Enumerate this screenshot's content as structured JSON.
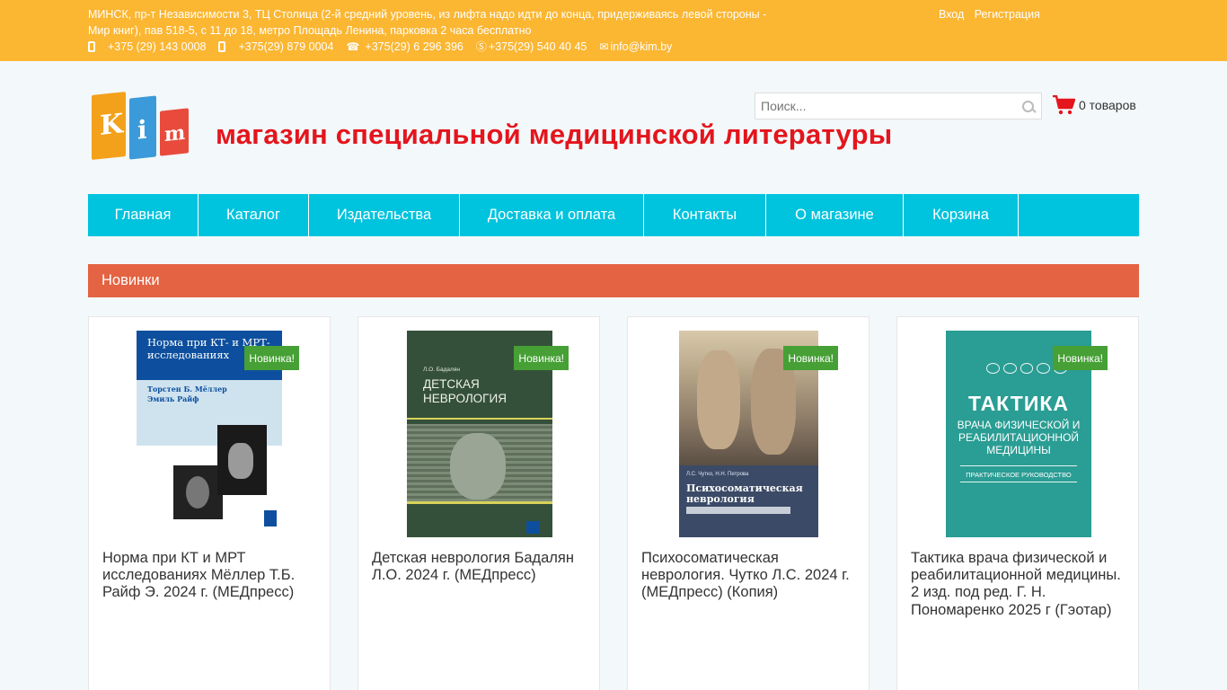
{
  "topbar": {
    "address": "МИНСК, пр-т Независимости 3, ТЦ Столица (2-й средний уровень, из лифта надо идти до конца, придерживаясь левой стороны - Мир книг), пав 518-5, с 11 до 18, метро Площадь Ленина, парковка 2 часа бесплатно",
    "phone1": "+375 (29) 143 0008",
    "phone2": "+375(29) 879 0004",
    "phone3": "+375(29) 6 296 396",
    "skype": "+375(29) 540 40 45",
    "email": "info@kim.by",
    "login": "Вход",
    "register": "Регистрация"
  },
  "header": {
    "logo_letters": [
      "K",
      "i",
      "m"
    ],
    "tagline": "магазин специальной медицинской литературы",
    "search_placeholder": "Поиск...",
    "cart_text": "0 товаров"
  },
  "nav": {
    "items": [
      "Главная",
      "Каталог",
      "Издательства",
      "Доставка и оплата",
      "Контакты",
      "О магазине",
      "Корзина"
    ]
  },
  "section_title": "Новинки",
  "products": [
    {
      "badge": "Новинка!",
      "title": "Норма при КТ и МРТ исследованиях Мёллер Т.Б. Райф Э. 2024 г. (МЕДпресс)",
      "cover_title": "Норма при КТ- и МРТ-исследованиях",
      "cover_authors": "Торстен Б. Мёллер Эмиль Райф"
    },
    {
      "badge": "Новинка!",
      "title": "Детская неврология Бадалян Л.О. 2024 г. (МЕДпресс)",
      "cover_author": "Л.О. Бадалян",
      "cover_title": "ДЕТСКАЯ НЕВРОЛОГИЯ"
    },
    {
      "badge": "Новинка!",
      "title": "Психосоматическая неврология. Чутко Л.С. 2024 г. (МЕДпресс) (Копия)",
      "cover_authors": "Л.С. Чутко, Н.Н. Петрова",
      "cover_title": "Психосоматическая неврология"
    },
    {
      "badge": "Новинка!",
      "title": "Тактика врача физической и реабилитационной медицины. 2 изд. под ред. Г. Н. Пономаренко 2025 г (Гэотар)",
      "cover_line1": "ТАКТИКА",
      "cover_line2": "ВРАЧА ФИЗИЧЕСКОЙ И РЕАБИЛИТАЦИОННОЙ МЕДИЦИНЫ",
      "cover_line3": "ПРАКТИЧЕСКОЕ РУКОВОДСТВО"
    }
  ]
}
